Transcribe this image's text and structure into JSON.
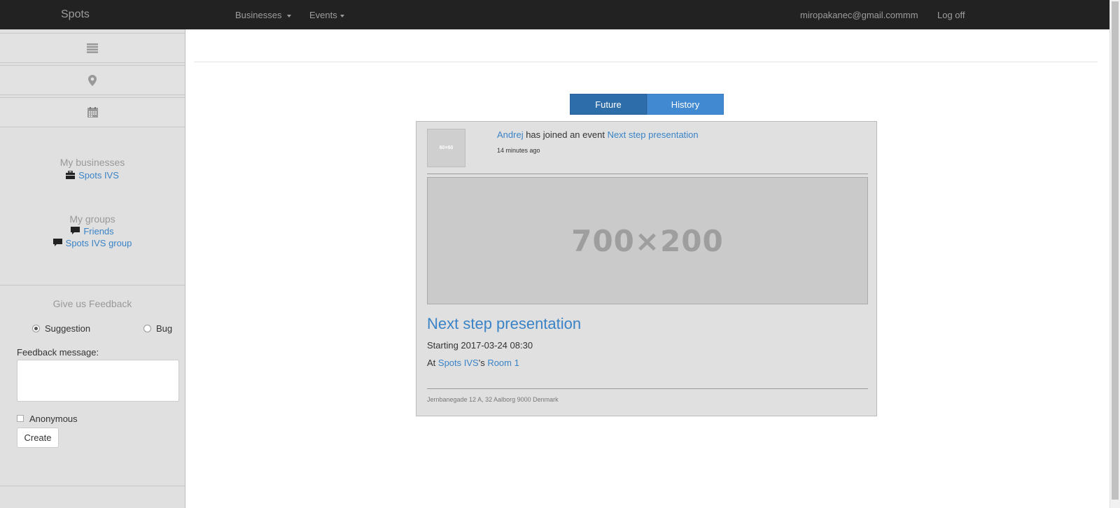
{
  "navbar": {
    "brand": "Spots",
    "menu": [
      {
        "label": "Businesses"
      },
      {
        "label": "Events"
      }
    ],
    "user_email": "miropakanec@gmail.commm",
    "logoff": "Log off"
  },
  "sidebar": {
    "icons": [
      "list-icon",
      "map-marker-icon",
      "calendar-icon"
    ],
    "my_businesses_title": "My businesses",
    "businesses": [
      {
        "label": "Spots IVS",
        "icon": "briefcase-icon"
      }
    ],
    "my_groups_title": "My groups",
    "groups": [
      {
        "label": "Friends",
        "icon": "comment-icon"
      },
      {
        "label": "Spots IVS group",
        "icon": "comment-icon"
      }
    ],
    "feedback": {
      "title": "Give us Feedback",
      "option_suggestion": "Suggestion",
      "option_bug": "Bug",
      "selected": "Suggestion",
      "message_label": "Feedback message:",
      "message_value": "",
      "anonymous_label": "Anonymous",
      "anonymous_checked": false,
      "create_button": "Create"
    }
  },
  "tabs": {
    "future": "Future",
    "history": "History",
    "active": "Future"
  },
  "feed": {
    "activity": {
      "user": "Andrej",
      "action": " has joined an event ",
      "event_link": "Next step presentation",
      "time": "14 minutes ago",
      "avatar_text": "60×60"
    },
    "placeholder_text": "700×200",
    "event": {
      "title": "Next step presentation",
      "starting": "Starting 2017-03-24 08:30",
      "at_prefix": "At ",
      "venue": "Spots IVS",
      "possessive": "'s ",
      "room": "Room 1",
      "address": "Jernbanegade 12 A, 32 Aalborg 9000 Denmark"
    }
  },
  "colors": {
    "navbar_bg": "#222222",
    "sidebar_bg": "#e0e0e0",
    "link": "#3a83c7",
    "tab_active": "#2d6da9",
    "tab_inactive": "#4189d0"
  }
}
